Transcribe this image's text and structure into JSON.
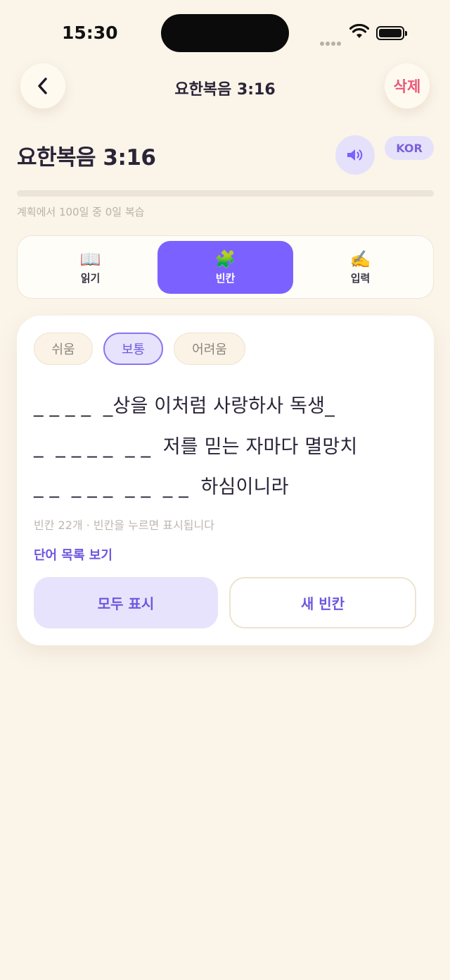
{
  "status_bar": {
    "time": "15:30"
  },
  "nav": {
    "title": "요한복음 3:16",
    "delete_label": "삭제"
  },
  "header": {
    "title": "요한복음 3:16",
    "language_badge": "KOR"
  },
  "progress": {
    "fraction": 0,
    "text": "계획에서 100일 중 0일 복습"
  },
  "mode_tabs": [
    {
      "icon": "📖",
      "label": "읽기",
      "active": false
    },
    {
      "icon": "🧩",
      "label": "빈칸",
      "active": true
    },
    {
      "icon": "✍️",
      "label": "입력",
      "active": false
    }
  ],
  "difficulty": {
    "options": [
      "쉬움",
      "보통",
      "어려움"
    ],
    "selected": "보통"
  },
  "verse_lines": [
    "_ _ _ _  _상을 이처럼 사랑하사 독생_",
    "_  _ _ _ _  _ _  저를 믿는 자마다 멸망치",
    "_ _  _ _ _  _ _  _ _  하심이니라"
  ],
  "hint_text": "빈칸 22개 · 빈칸을 누르면 표시됩니다",
  "word_list_link": "단어 목록 보기",
  "actions": {
    "show_all": "모두 표시",
    "new_blanks": "새 빈칸"
  },
  "colors": {
    "background": "#fbf4e9",
    "accent": "#7b61ff",
    "accent_soft": "#e8e3fc",
    "danger": "#e8587a"
  }
}
